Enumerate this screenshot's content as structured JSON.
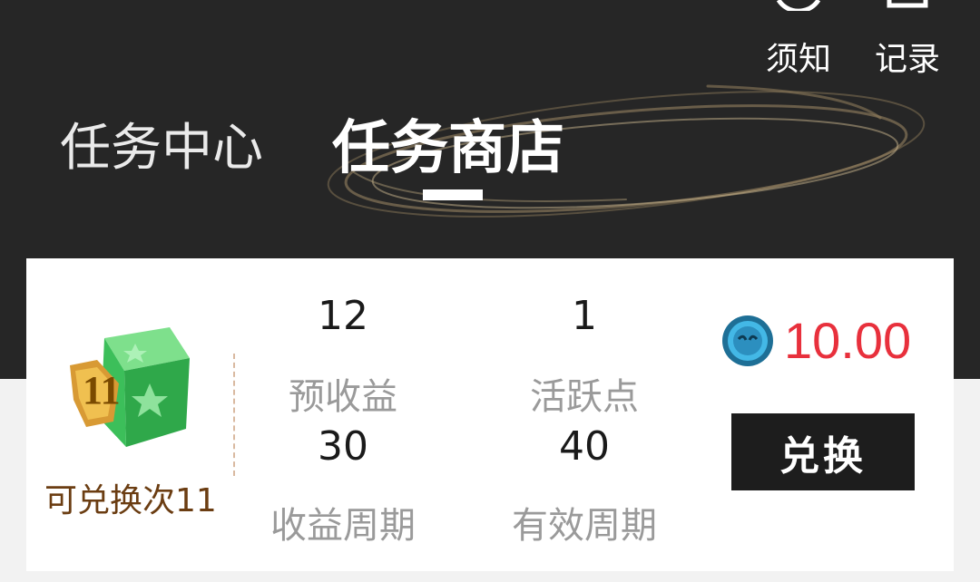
{
  "header": {
    "notice_label": "须知",
    "record_label": "记录",
    "tabs": [
      {
        "label": "任务中心",
        "active": false
      },
      {
        "label": "任务商店",
        "active": true
      }
    ]
  },
  "item": {
    "badge_number": "11",
    "exchange_count_label": "可兑换次11",
    "stats": [
      {
        "value": "12",
        "label": "预收益"
      },
      {
        "value": "1",
        "label": "活跃点"
      },
      {
        "value": "30",
        "label": "收益周期"
      },
      {
        "value": "40",
        "label": "有效周期"
      }
    ],
    "price": "10.00",
    "price_icon": "coin-icon",
    "exchange_button": "兑换"
  },
  "colors": {
    "header_bg": "#262626",
    "price": "#e8303c",
    "button_bg": "#1d1d1d",
    "count_text": "#6b3d12"
  }
}
